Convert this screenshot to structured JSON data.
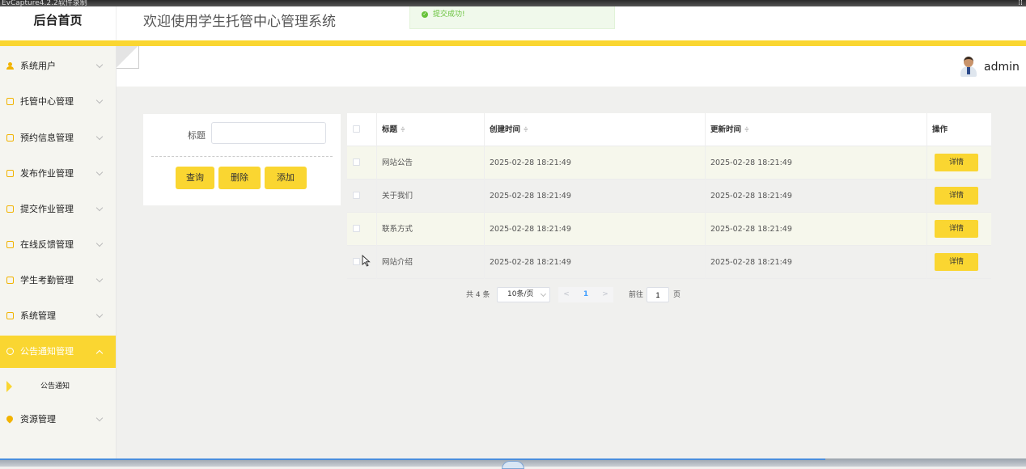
{
  "capture_bar": {
    "title": "EvCapture4.2.2软件录制",
    "right_text": "⁞⁞"
  },
  "header": {
    "brand": "后台首页",
    "system_title": "欢迎使用学生托管中心管理系统",
    "toast": {
      "text": "提交成功!",
      "icon": "check-circle-icon"
    }
  },
  "sidebar": {
    "items": [
      {
        "label": "系统用户",
        "icon": "user-icon"
      },
      {
        "label": "托管中心管理",
        "icon": "folder-icon"
      },
      {
        "label": "预约信息管理",
        "icon": "folder-icon"
      },
      {
        "label": "发布作业管理",
        "icon": "folder-icon"
      },
      {
        "label": "提交作业管理",
        "icon": "folder-icon"
      },
      {
        "label": "在线反馈管理",
        "icon": "folder-icon"
      },
      {
        "label": "学生考勤管理",
        "icon": "folder-icon"
      },
      {
        "label": "系统管理",
        "icon": "image-icon"
      },
      {
        "label": "公告通知管理",
        "icon": "info-icon",
        "active": true
      },
      {
        "label": "资源管理",
        "icon": "location-pin-icon"
      }
    ],
    "submenu": {
      "label": "公告通知"
    }
  },
  "topbar": {
    "username": "admin"
  },
  "search": {
    "label": "标题",
    "value": "",
    "placeholder": "",
    "buttons": {
      "query": "查询",
      "delete": "删除",
      "add": "添加"
    }
  },
  "table": {
    "columns": [
      "标题",
      "创建时间",
      "更新时间",
      "操作"
    ],
    "sort_glyph": "≑",
    "rows": [
      {
        "title": "网站公告",
        "created": "2025-02-28 18:21:49",
        "updated": "2025-02-28 18:21:49",
        "action": "详情"
      },
      {
        "title": "关于我们",
        "created": "2025-02-28 18:21:49",
        "updated": "2025-02-28 18:21:49",
        "action": "详情"
      },
      {
        "title": "联系方式",
        "created": "2025-02-28 18:21:49",
        "updated": "2025-02-28 18:21:49",
        "action": "详情"
      },
      {
        "title": "网站介绍",
        "created": "2025-02-28 18:21:49",
        "updated": "2025-02-28 18:21:49",
        "action": "详情"
      }
    ]
  },
  "pagination": {
    "total": "共 4 条",
    "page_size": "10条/页",
    "prev": "<",
    "current": "1",
    "next": ">",
    "goto_prefix": "前往",
    "goto_value": "1",
    "goto_suffix": "页"
  },
  "colors": {
    "accent": "#fad631",
    "success": "#67c23a",
    "link": "#409eff"
  }
}
